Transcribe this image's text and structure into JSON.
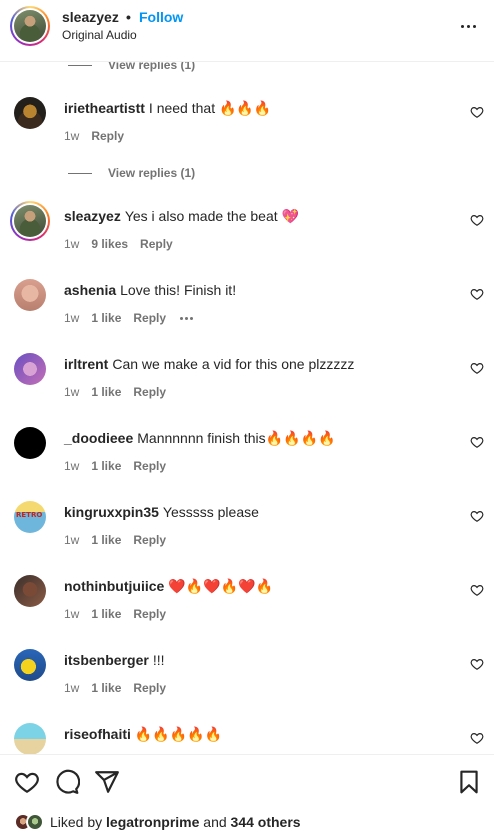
{
  "header": {
    "username": "sleazyez",
    "separator": "•",
    "follow_label": "Follow",
    "subtitle": "Original Audio"
  },
  "replies_label": "View replies (1)",
  "comments": [
    {
      "username": "irietheartistt",
      "text": "I need that 🔥🔥🔥",
      "time": "1w",
      "likes": "",
      "reply": "Reply"
    },
    {
      "username": "sleazyez",
      "text": "Yes i also made the beat 💖",
      "time": "1w",
      "likes": "9 likes",
      "reply": "Reply"
    },
    {
      "username": "ashenia",
      "text": "Love this! Finish it!",
      "time": "1w",
      "likes": "1 like",
      "reply": "Reply"
    },
    {
      "username": "irltrent",
      "text": "Can we make a vid for this one plzzzzz",
      "time": "1w",
      "likes": "1 like",
      "reply": "Reply"
    },
    {
      "username": "_doodieee",
      "text": "Mannnnnn finish this🔥🔥🔥🔥",
      "time": "1w",
      "likes": "1 like",
      "reply": "Reply"
    },
    {
      "username": "kingruxxpin35",
      "text": "Yesssss please",
      "time": "1w",
      "likes": "1 like",
      "reply": "Reply"
    },
    {
      "username": "nothinbutjuiice",
      "text": "❤️🔥❤️🔥❤️🔥",
      "time": "1w",
      "likes": "1 like",
      "reply": "Reply"
    },
    {
      "username": "itsbenberger",
      "text": "!!!",
      "time": "1w",
      "likes": "1 like",
      "reply": "Reply"
    },
    {
      "username": "riseofhaiti",
      "text": "🔥🔥🔥🔥🔥",
      "time": "",
      "likes": "",
      "reply": ""
    }
  ],
  "avatar_text": {
    "kingrux": "RETRO"
  },
  "footer": {
    "liked_prefix": "Liked by",
    "liked_user": "legatronprime",
    "liked_and": "and",
    "liked_count": "344 others"
  },
  "colors": {
    "accent": "#0095f6",
    "text": "#262626",
    "secondary": "#737373"
  },
  "icons": [
    "more-icon",
    "heart-icon",
    "comment-icon",
    "share-icon",
    "bookmark-icon"
  ]
}
